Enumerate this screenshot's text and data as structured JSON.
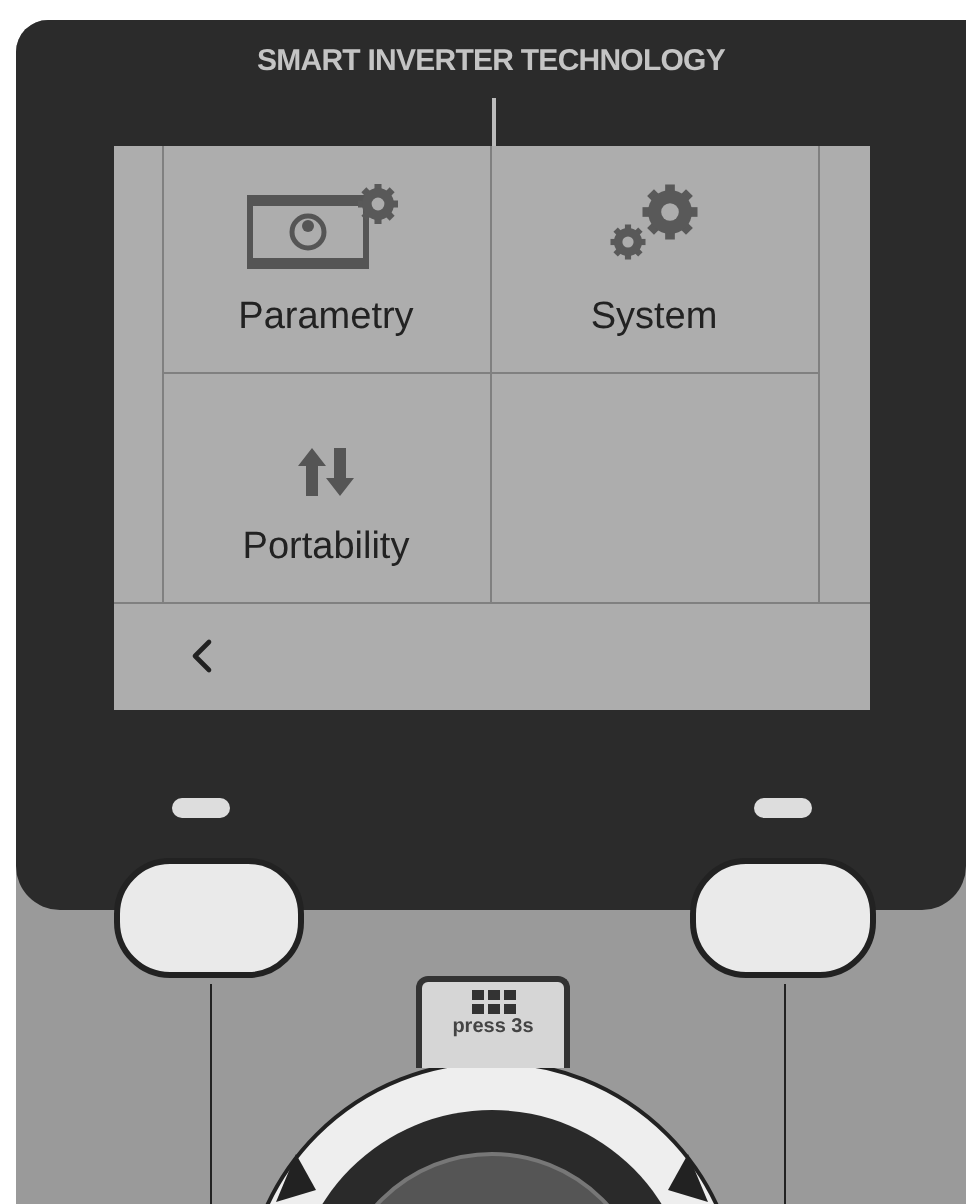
{
  "panel": {
    "brand": "SMART INVERTER TECHNOLOGY"
  },
  "screen": {
    "tiles": [
      {
        "label": "Parametry",
        "kind": "parameters"
      },
      {
        "label": "System",
        "kind": "system"
      },
      {
        "label": "Portability",
        "kind": "transfer"
      }
    ]
  },
  "controls": {
    "center_button": "press 3s"
  }
}
